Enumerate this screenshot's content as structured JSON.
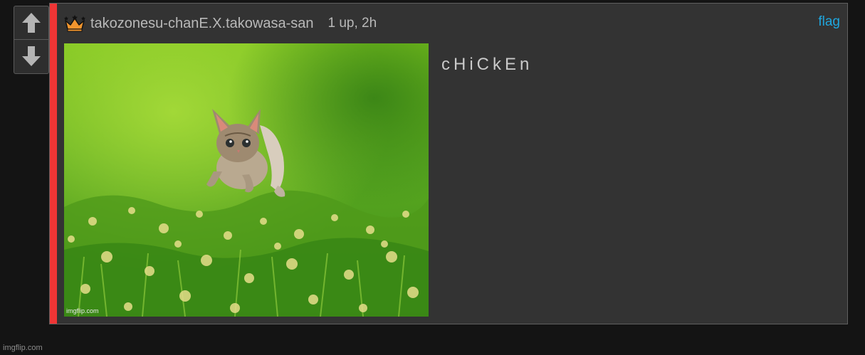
{
  "vote": {
    "up_icon": "arrow-up-icon",
    "down_icon": "arrow-down-icon"
  },
  "comment": {
    "accent_color": "#ef3535",
    "badge_icon": "crown-icon",
    "username": "takozonesu-chanE.X.takowasa-san",
    "meta": "1 up, 2h",
    "flag_label": "flag",
    "flag_color": "#1fa6de",
    "text": "cHiCkEn",
    "image": {
      "description_icon": "kitten-running-in-grass-image",
      "watermark": "imgflip.com"
    }
  },
  "footer": {
    "watermark": "imgflip.com"
  }
}
